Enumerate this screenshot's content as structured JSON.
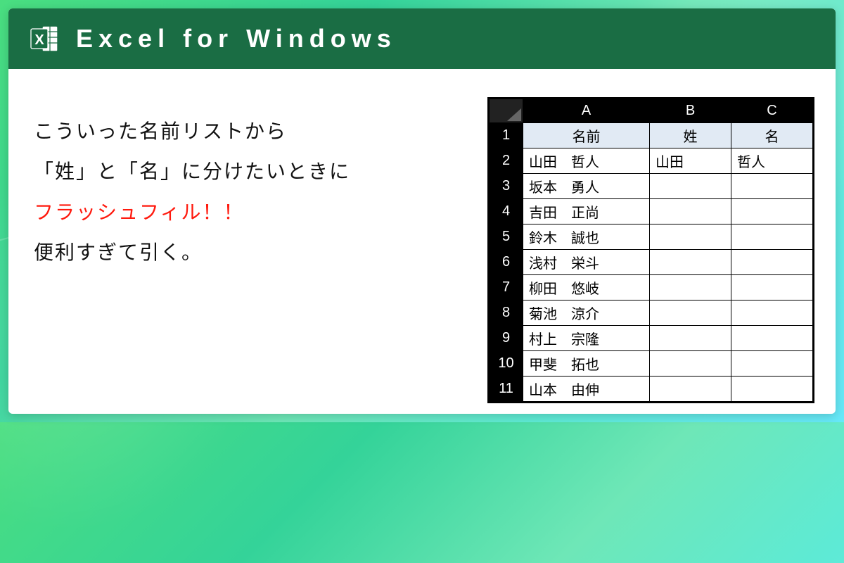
{
  "header": {
    "title": "Excel for Windows"
  },
  "left": {
    "line1": "こういった名前リストから",
    "line2": "「姓」と「名」に分けたいときに",
    "line3": "フラッシュフィル！！",
    "line4": "便利すぎて引く。"
  },
  "table": {
    "cols": {
      "A": "A",
      "B": "B",
      "C": "C"
    },
    "header_row": {
      "n": "1",
      "a": "名前",
      "b": "姓",
      "c": "名"
    },
    "rows": [
      {
        "n": "2",
        "a": "山田　哲人",
        "b": "山田",
        "c": "哲人"
      },
      {
        "n": "3",
        "a": "坂本　勇人",
        "b": "",
        "c": ""
      },
      {
        "n": "4",
        "a": "吉田　正尚",
        "b": "",
        "c": ""
      },
      {
        "n": "5",
        "a": "鈴木　誠也",
        "b": "",
        "c": ""
      },
      {
        "n": "6",
        "a": "浅村　栄斗",
        "b": "",
        "c": ""
      },
      {
        "n": "7",
        "a": "柳田　悠岐",
        "b": "",
        "c": ""
      },
      {
        "n": "8",
        "a": "菊池　涼介",
        "b": "",
        "c": ""
      },
      {
        "n": "9",
        "a": "村上　宗隆",
        "b": "",
        "c": ""
      },
      {
        "n": "10",
        "a": "甲斐　拓也",
        "b": "",
        "c": ""
      },
      {
        "n": "11",
        "a": "山本　由伸",
        "b": "",
        "c": ""
      }
    ]
  }
}
